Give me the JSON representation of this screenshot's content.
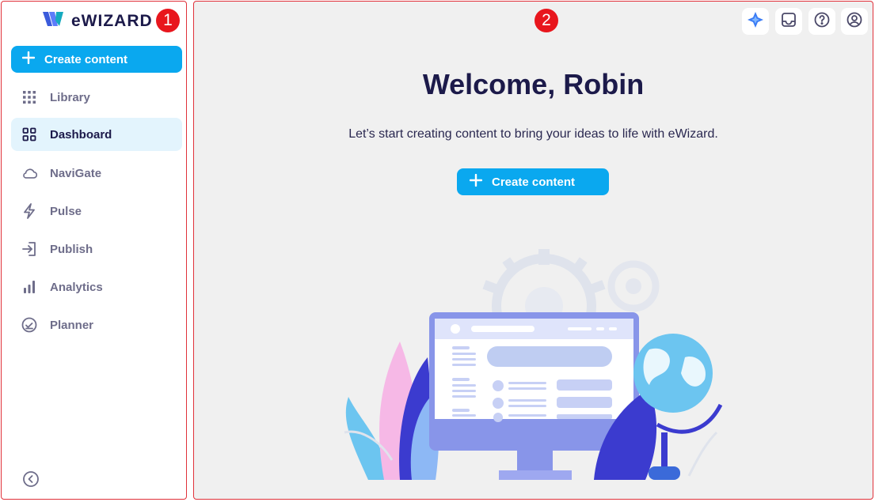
{
  "brand": {
    "name": "eWIZARD",
    "logo_icon": "ewizard-logo-icon"
  },
  "annotations": {
    "sidebar_badge": "1",
    "main_badge": "2"
  },
  "sidebar": {
    "create_label": "Create content",
    "items": [
      {
        "label": "Library",
        "icon": "grid-icon",
        "active": false
      },
      {
        "label": "Dashboard",
        "icon": "dashboard-icon",
        "active": true
      },
      {
        "label": "NaviGate",
        "icon": "cloud-icon",
        "active": false
      },
      {
        "label": "Pulse",
        "icon": "lightning-icon",
        "active": false
      },
      {
        "label": "Publish",
        "icon": "publish-icon",
        "active": false
      },
      {
        "label": "Analytics",
        "icon": "bar-chart-icon",
        "active": false
      },
      {
        "label": "Planner",
        "icon": "calendar-check-icon",
        "active": false
      }
    ],
    "collapse_icon": "chevron-left-circle-icon"
  },
  "header_icons": [
    "ai-sparkle-icon",
    "inbox-icon",
    "help-icon",
    "user-icon"
  ],
  "main": {
    "title": "Welcome, Robin",
    "subtitle": "Let’s start creating content to bring your ideas to life with eWizard.",
    "create_label": "Create content"
  },
  "colors": {
    "accent": "#0aa8ef",
    "active_bg": "#e3f4fd",
    "badge": "#e8161d",
    "title": "#1c1a4a",
    "main_bg": "#f0f0f0"
  }
}
